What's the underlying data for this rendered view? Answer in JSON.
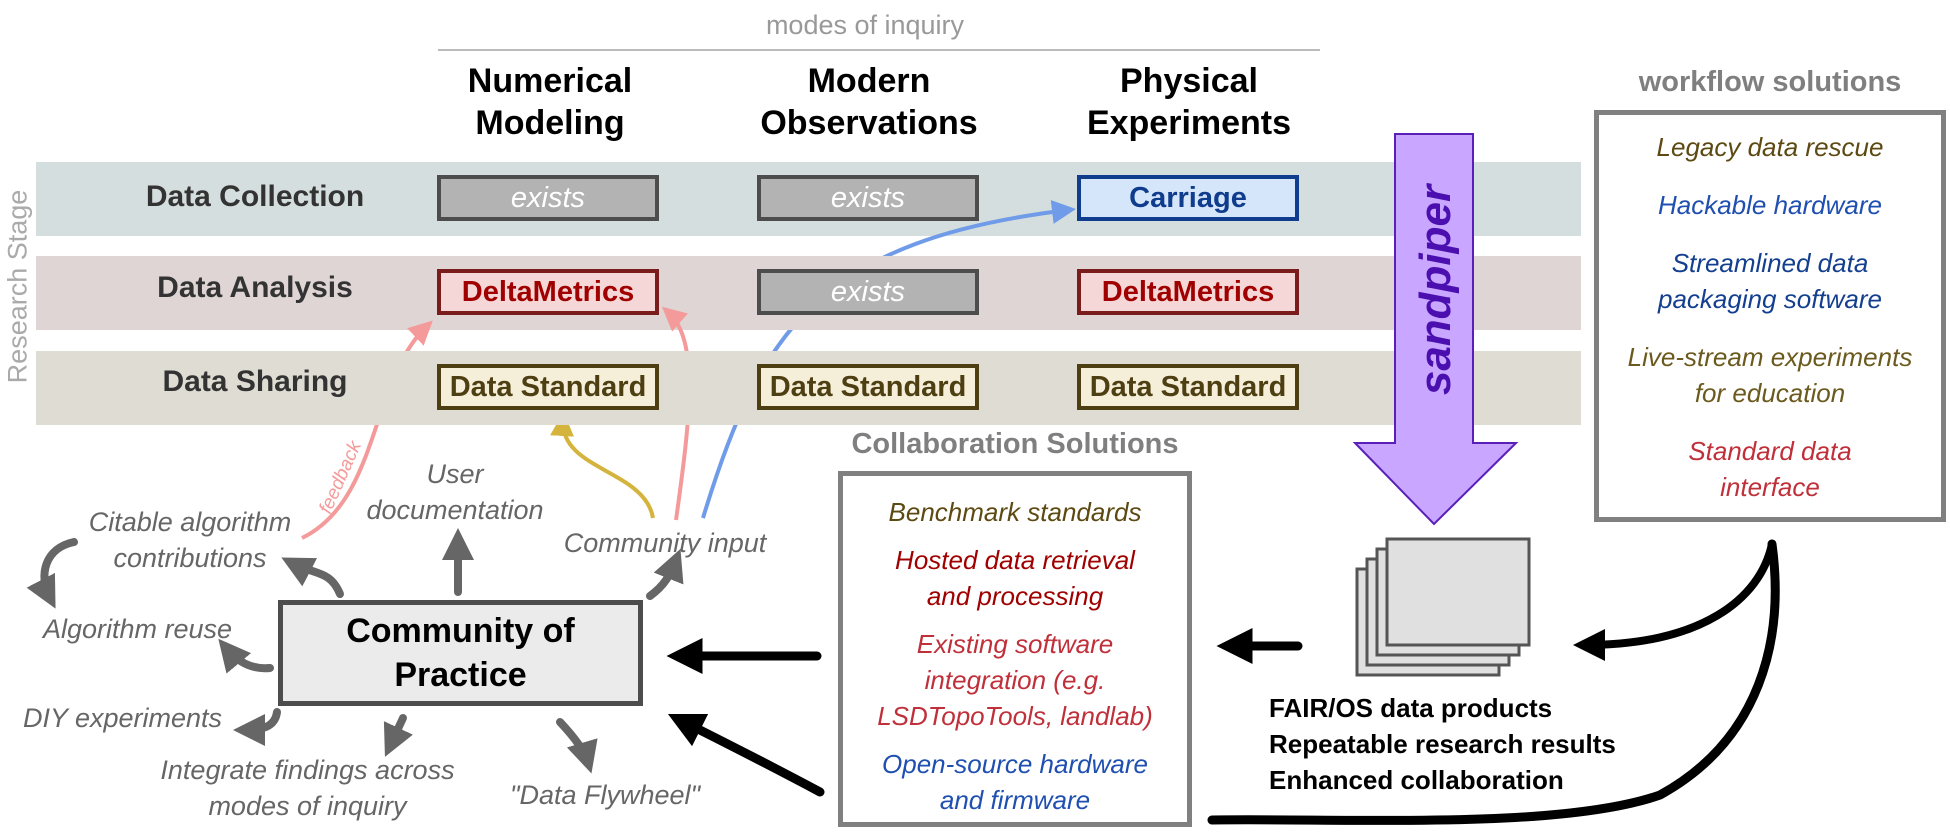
{
  "header": {
    "modes_label": "modes of inquiry",
    "axis_label": "Research Stage",
    "modes": [
      {
        "line1": "Numerical",
        "line2": "Modeling"
      },
      {
        "line1": "Modern",
        "line2": "Observations"
      },
      {
        "line1": "Physical",
        "line2": "Experiments"
      }
    ]
  },
  "stages": [
    {
      "label": "Data Collection",
      "cells": [
        "exists",
        "exists",
        "Carriage"
      ]
    },
    {
      "label": "Data Analysis",
      "cells": [
        "DeltaMetrics",
        "exists",
        "DeltaMetrics"
      ]
    },
    {
      "label": "Data Sharing",
      "cells": [
        "Data Standard",
        "Data Standard",
        "Data Standard"
      ]
    }
  ],
  "sandpiper": {
    "label": "sandpiper",
    "color": "#c9a6ff",
    "border": "#5a1fb8",
    "text_color": "#4b0fb0"
  },
  "workflow": {
    "title": "workflow solutions",
    "items": [
      {
        "lines": [
          "Legacy data rescue"
        ],
        "color": "#5c4a12"
      },
      {
        "lines": [
          "Hackable hardware"
        ],
        "color": "#1f4fb0"
      },
      {
        "lines": [
          "Streamlined data",
          "packaging software"
        ],
        "color": "#143f8f"
      },
      {
        "lines": [
          "Live-stream experiments",
          "for education"
        ],
        "color": "#6b5a1e"
      },
      {
        "lines": [
          "Standard data",
          "interface"
        ],
        "color": "#c0303a"
      }
    ]
  },
  "collaboration": {
    "title": "Collaboration Solutions",
    "items": [
      {
        "lines": [
          "Benchmark standards"
        ],
        "color": "#5c4a12"
      },
      {
        "lines": [
          "Hosted data retrieval",
          "and processing"
        ],
        "color": "#a00000"
      },
      {
        "lines": [
          "Existing software",
          "integration (e.g.",
          "LSDTopoTools, landlab)"
        ],
        "color": "#c0303a"
      },
      {
        "lines": [
          "Open-source hardware",
          "and firmware"
        ],
        "color": "#1f4fb0"
      }
    ]
  },
  "outputs": {
    "lines": [
      "FAIR/OS data products",
      "Repeatable research results",
      "Enhanced collaboration"
    ]
  },
  "community": {
    "title_line1": "Community of",
    "title_line2": "Practice",
    "outcomes": {
      "citable": [
        "Citable algorithm",
        "contributions"
      ],
      "user_doc": [
        "User",
        "documentation"
      ],
      "community_input": "Community input",
      "algorithm_reuse": "Algorithm reuse",
      "diy": "DIY experiments",
      "integrate": [
        "Integrate findings across",
        "modes of inquiry"
      ],
      "flywheel": "\"Data Flywheel\""
    },
    "feedback_label": "feedback"
  },
  "colors": {
    "feedback_pink": "#f59a9a",
    "observation_blue": "#6f9be8",
    "standard_yellow": "#d4b43c",
    "gray_arrow": "#666666"
  }
}
